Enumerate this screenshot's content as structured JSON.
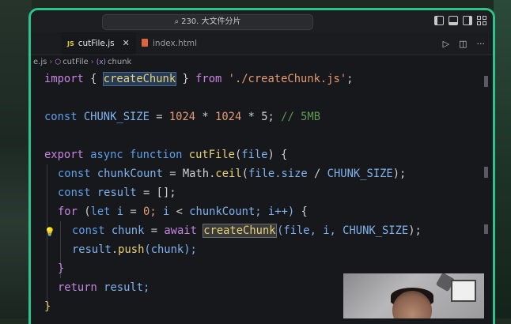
{
  "titlebar": {
    "search_text": "230. 大文件分片"
  },
  "tabs": [
    {
      "label": "cutFile.js",
      "type": "JS",
      "active": true
    },
    {
      "label": "index.html",
      "type": "HTML",
      "active": false
    }
  ],
  "tab_overflow_left": "",
  "breadcrumb": {
    "file": "e.js",
    "function": "cutFile",
    "symbol": "chunk"
  },
  "code": {
    "line1": [
      "import",
      "{",
      "createChunk",
      "}",
      "from",
      "'./createChunk.js'",
      ";"
    ],
    "line3": [
      "const",
      "CHUNK_SIZE",
      "=",
      "1024",
      "*",
      "1024",
      "*",
      "5;",
      "// 5MB"
    ],
    "line5": [
      "export",
      "async",
      "function",
      "cutFile",
      "(",
      "file",
      ")",
      "{"
    ],
    "line6": [
      "const",
      "chunkCount",
      "=",
      "Math",
      ".",
      "ceil",
      "(",
      "file.size",
      "/",
      "CHUNK_SIZE",
      ");"
    ],
    "line7": [
      "const",
      "result",
      "=",
      "[];"
    ],
    "line8": [
      "for",
      "(",
      "let",
      "i",
      "=",
      "0;",
      "i",
      "<",
      "chunkCount;",
      "i++)",
      "{"
    ],
    "line9": [
      "const",
      "chunk",
      "=",
      "await",
      "createChunk",
      "(file, i,",
      "CHUNK_SIZE",
      ");"
    ],
    "line10": [
      "result",
      ".",
      "push",
      "(chunk);"
    ],
    "line11": [
      "}"
    ],
    "line12": [
      "return",
      "result;"
    ],
    "line13": [
      "}"
    ]
  },
  "colors": {
    "accent_border": "#2bc48a",
    "keyword": "#5f9fe9",
    "function": "#e8d37a",
    "string": "#e39b74",
    "comment": "#5f9a55"
  }
}
